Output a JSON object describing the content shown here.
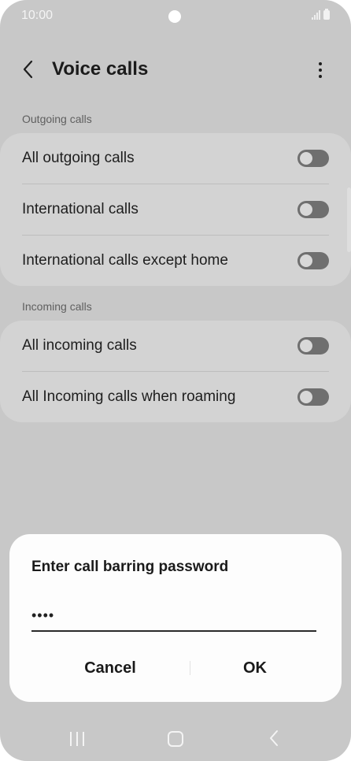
{
  "status": {
    "time": "10:00"
  },
  "header": {
    "title": "Voice calls"
  },
  "sections": [
    {
      "label": "Outgoing calls",
      "items": [
        {
          "label": "All outgoing calls",
          "enabled": false
        },
        {
          "label": "International calls",
          "enabled": false
        },
        {
          "label": "International calls except home",
          "enabled": false
        }
      ]
    },
    {
      "label": "Incoming calls",
      "items": [
        {
          "label": "All incoming calls",
          "enabled": false
        },
        {
          "label": "All Incoming calls when roaming",
          "enabled": false
        }
      ]
    }
  ],
  "dialog": {
    "title": "Enter call barring password",
    "password_value": "••••",
    "cancel_label": "Cancel",
    "ok_label": "OK"
  },
  "icons": {
    "back": "back-arrow-icon",
    "more": "more-vertical-icon",
    "nav_recents": "recents-icon",
    "nav_home": "home-icon",
    "nav_back": "nav-back-icon"
  },
  "colors": {
    "background": "#c8c8c8",
    "card": "#d3d3d3",
    "switch_off_track": "#6f6f6f",
    "dialog": "#fdfdfd"
  }
}
